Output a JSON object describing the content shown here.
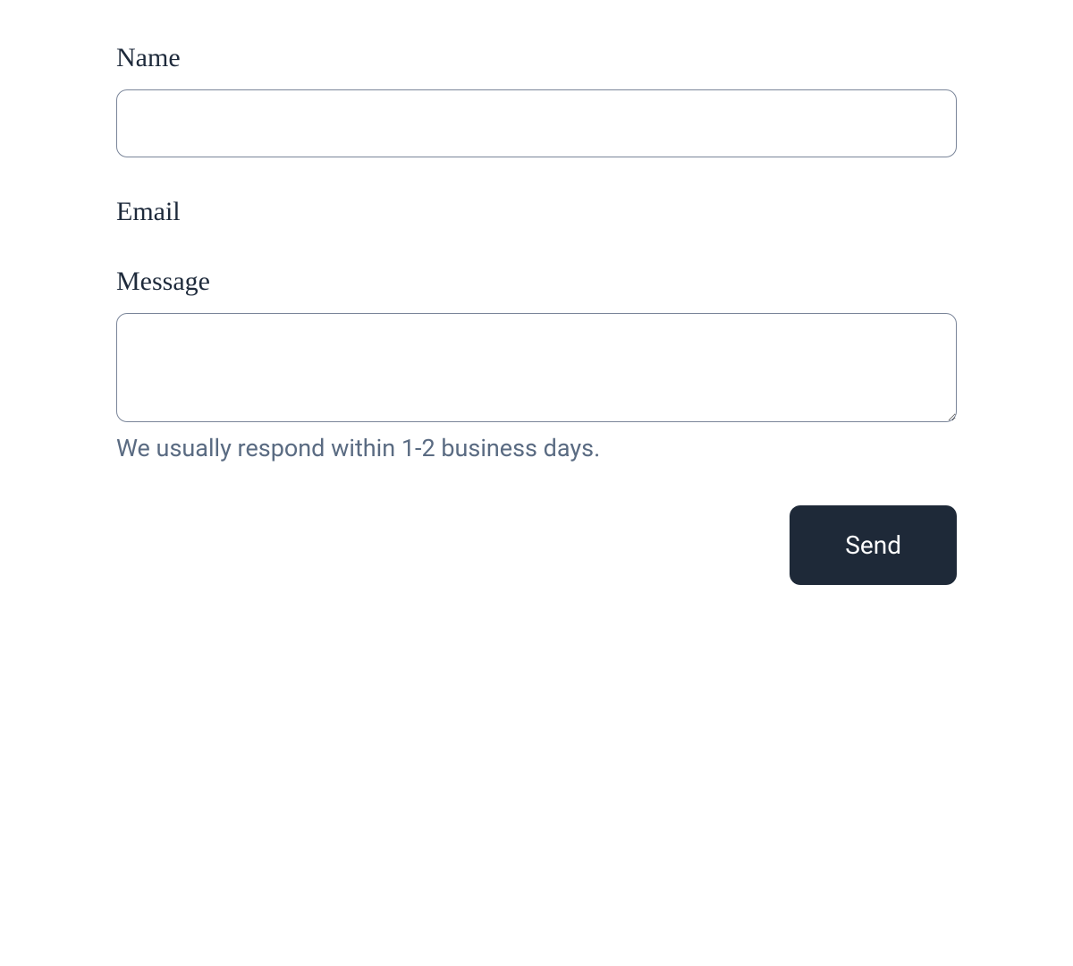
{
  "form": {
    "name": {
      "label": "Name",
      "value": ""
    },
    "email": {
      "label": "Email",
      "value": ""
    },
    "message": {
      "label": "Message",
      "value": "",
      "help_text": "We usually respond within 1-2 business days."
    },
    "submit_label": "Send"
  }
}
